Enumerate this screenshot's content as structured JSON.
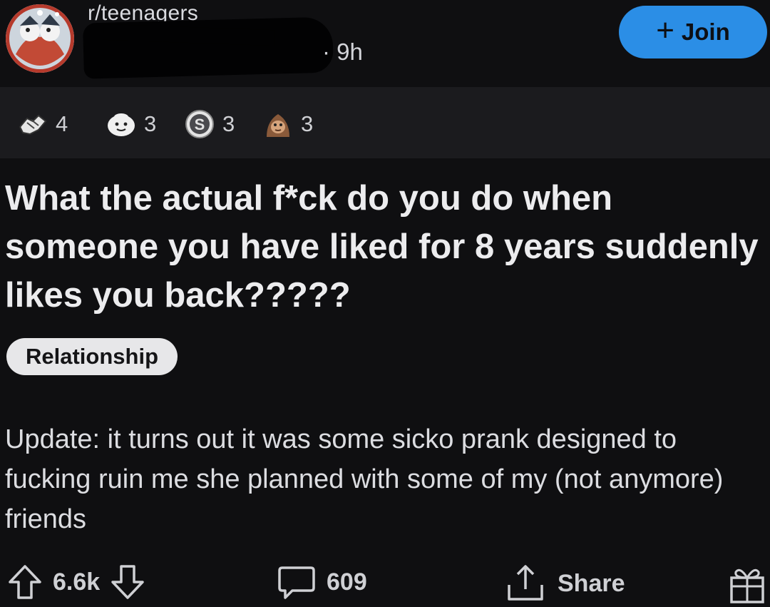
{
  "header": {
    "subreddit": "r/teenagers",
    "age": "· 9h",
    "join_label": "Join",
    "join_icon": "plus-icon"
  },
  "awards": [
    {
      "icon": "helping-hand-icon",
      "count": "4"
    },
    {
      "icon": "wholesome-seal-icon",
      "count": "3"
    },
    {
      "icon": "silver-coin-icon",
      "count": "3"
    },
    {
      "icon": "monkey-award-icon",
      "count": "3"
    }
  ],
  "post": {
    "title": "What the actual f*ck do you do when someone you have liked for 8 years suddenly likes you back?????",
    "flair": "Relationship",
    "body": "Update: it turns out it was some sicko prank designed to fucking ruin me she planned with some of my (not anymore) friends"
  },
  "actions": {
    "votes": "6.6k",
    "comments": "609",
    "share_label": "Share"
  },
  "colors": {
    "background": "#0f0f11",
    "awards_strip": "#1b1b1e",
    "join_button": "#2b8ee6",
    "flair_bg": "#e7e7e9",
    "text": "#ececee"
  }
}
